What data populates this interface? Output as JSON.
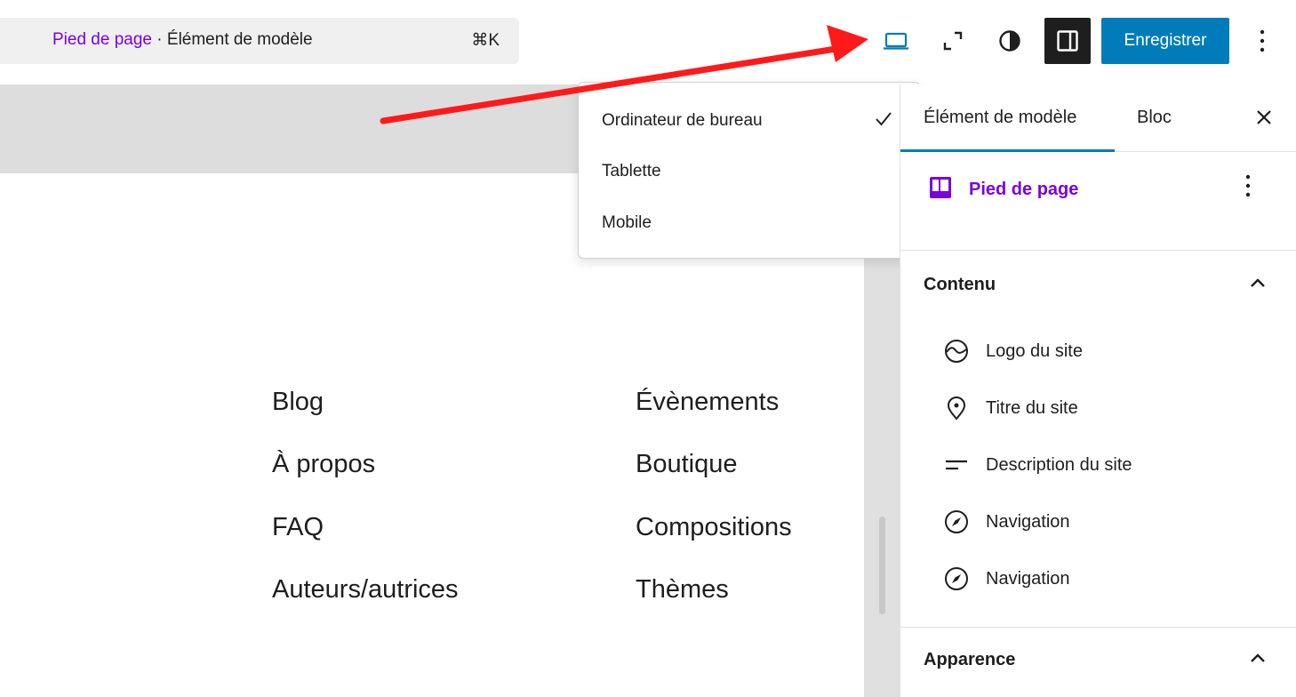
{
  "topbar": {
    "breadcrumb_link": "Pied de page",
    "breadcrumb_separator": " · ",
    "breadcrumb_type": "Élément de modèle",
    "shortcut": "⌘K",
    "device_icon": "laptop-icon",
    "zoom_icon": "fullscreen-icon",
    "style_icon": "contrast-icon",
    "settings_icon": "sidebar-toggle-icon",
    "save_label": "Enregistrer",
    "options_icon": "more-vertical-icon"
  },
  "device_menu": {
    "items": [
      {
        "label": "Ordinateur de bureau",
        "checked": true
      },
      {
        "label": "Tablette",
        "checked": false
      },
      {
        "label": "Mobile",
        "checked": false
      }
    ]
  },
  "canvas": {
    "links_left": [
      "Blog",
      "À propos",
      "FAQ",
      "Auteurs/autrices"
    ],
    "links_right": [
      "Évènements",
      "Boutique",
      "Compositions",
      "Thèmes"
    ]
  },
  "sidebar": {
    "tabs": [
      "Élément de modèle",
      "Bloc"
    ],
    "active_tab": "Élément de modèle",
    "template_title": "Pied de page",
    "content_section": "Contenu",
    "content_items": [
      {
        "label": "Logo du site",
        "icon": "site-logo-icon"
      },
      {
        "label": "Titre du site",
        "icon": "map-marker-icon"
      },
      {
        "label": "Description du site",
        "icon": "description-icon"
      },
      {
        "label": "Navigation",
        "icon": "compass-icon"
      },
      {
        "label": "Navigation",
        "icon": "compass-icon"
      }
    ],
    "appearance_section": "Apparence"
  },
  "colors": {
    "accent": "#007cba",
    "template_purple": "#7a00df",
    "annotation_red": "#ff0000",
    "dark": "#1e1e1e"
  }
}
